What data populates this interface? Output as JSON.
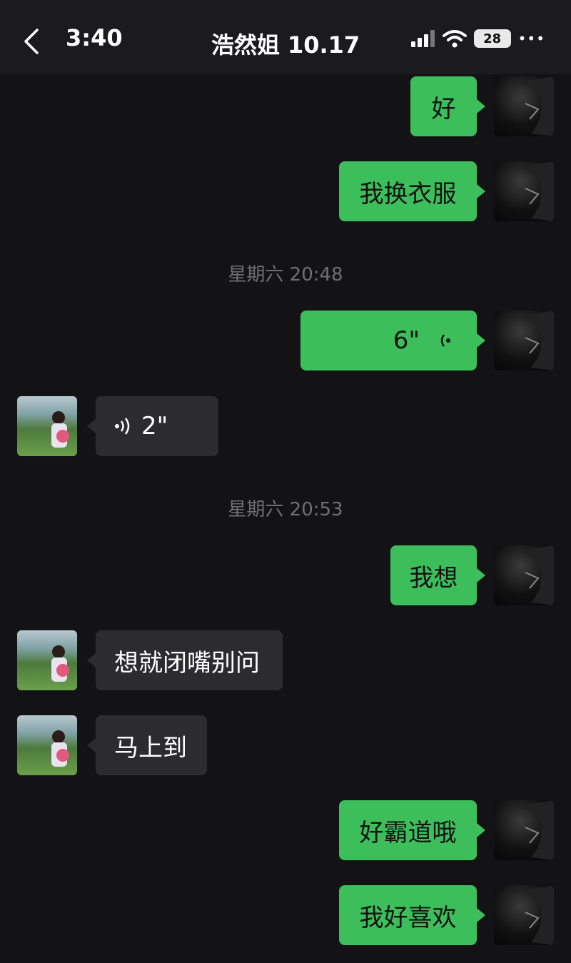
{
  "status": {
    "time": "3:40",
    "battery": "28"
  },
  "header": {
    "title": "浩然姐 10.17"
  },
  "messages": [
    {
      "from": "me",
      "text": "好"
    },
    {
      "from": "me",
      "text": "我换衣服"
    },
    {
      "timestamp": "星期六 20:48"
    },
    {
      "from": "me",
      "voice_duration": "6\""
    },
    {
      "from": "her",
      "voice_duration": "2\""
    },
    {
      "timestamp": "星期六 20:53"
    },
    {
      "from": "me",
      "text": "我想"
    },
    {
      "from": "her",
      "text": "想就闭嘴别问"
    },
    {
      "from": "her",
      "text": "马上到"
    },
    {
      "from": "me",
      "text": "好霸道哦"
    },
    {
      "from": "me",
      "text": "我好喜欢"
    }
  ],
  "colors": {
    "my_bubble": "#3cbe5b",
    "her_bubble": "#2c2c2e",
    "background": "#131215"
  }
}
